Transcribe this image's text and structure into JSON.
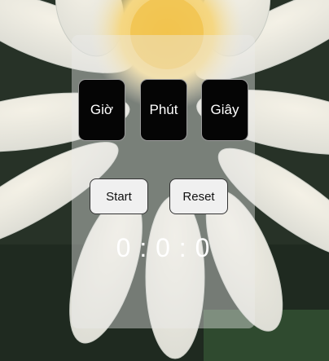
{
  "colors": {
    "unit_box_bg": "#050505",
    "button_bg": "#f0f0f0",
    "display_text": "#ffffff"
  },
  "units": {
    "hours": "Giờ",
    "minutes": "Phút",
    "seconds": "Giây"
  },
  "controls": {
    "start_label": "Start",
    "reset_label": "Reset"
  },
  "timer": {
    "display": "0 : 0 : 0"
  }
}
